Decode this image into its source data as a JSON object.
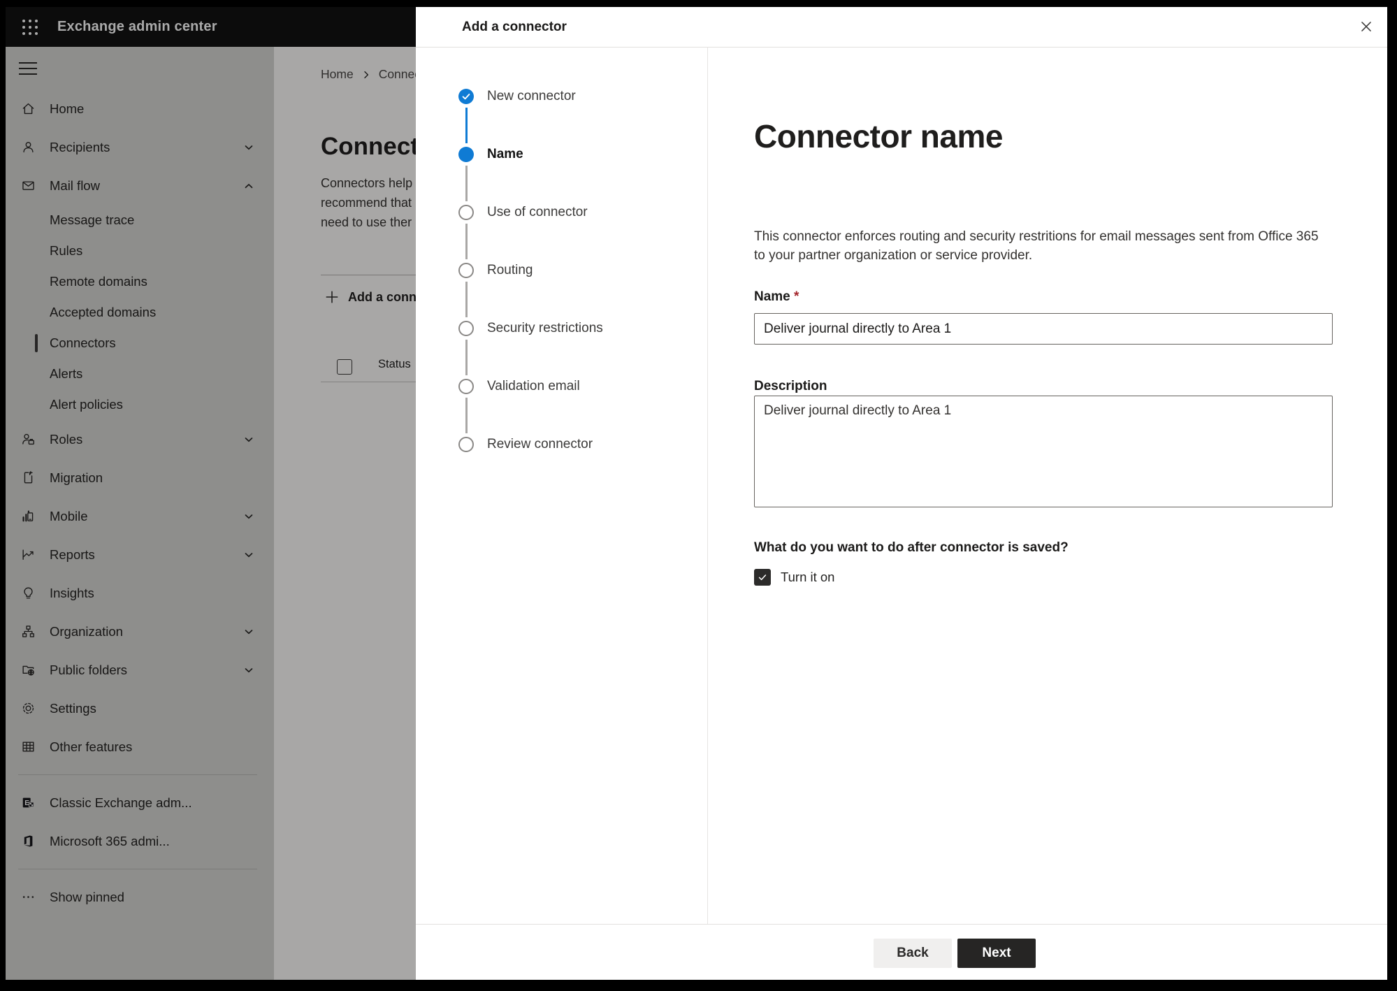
{
  "topbar": {
    "title": "Exchange admin center"
  },
  "sidebar": {
    "items": [
      {
        "label": "Home",
        "icon": "home-icon",
        "type": "item",
        "chevron": null,
        "selected": false
      },
      {
        "label": "Recipients",
        "icon": "person-icon",
        "type": "item",
        "chevron": "down",
        "selected": false
      },
      {
        "label": "Mail flow",
        "icon": "mail-icon",
        "type": "item",
        "chevron": "up",
        "selected": false
      },
      {
        "label": "Message trace",
        "icon": null,
        "type": "sub",
        "chevron": null,
        "selected": false
      },
      {
        "label": "Rules",
        "icon": null,
        "type": "sub",
        "chevron": null,
        "selected": false
      },
      {
        "label": "Remote domains",
        "icon": null,
        "type": "sub",
        "chevron": null,
        "selected": false
      },
      {
        "label": "Accepted domains",
        "icon": null,
        "type": "sub",
        "chevron": null,
        "selected": false
      },
      {
        "label": "Connectors",
        "icon": null,
        "type": "sub",
        "chevron": null,
        "selected": true
      },
      {
        "label": "Alerts",
        "icon": null,
        "type": "sub",
        "chevron": null,
        "selected": false
      },
      {
        "label": "Alert policies",
        "icon": null,
        "type": "sub",
        "chevron": null,
        "selected": false
      },
      {
        "label": "Roles",
        "icon": "roles-icon",
        "type": "item",
        "chevron": "down",
        "selected": false
      },
      {
        "label": "Migration",
        "icon": "migration-icon",
        "type": "item",
        "chevron": null,
        "selected": false
      },
      {
        "label": "Mobile",
        "icon": "mobile-icon",
        "type": "item",
        "chevron": "down",
        "selected": false
      },
      {
        "label": "Reports",
        "icon": "reports-icon",
        "type": "item",
        "chevron": "down",
        "selected": false
      },
      {
        "label": "Insights",
        "icon": "lightbulb-icon",
        "type": "item",
        "chevron": null,
        "selected": false
      },
      {
        "label": "Organization",
        "icon": "org-tree-icon",
        "type": "item",
        "chevron": "down",
        "selected": false
      },
      {
        "label": "Public folders",
        "icon": "folder-globe-icon",
        "type": "item",
        "chevron": "down",
        "selected": false
      },
      {
        "label": "Settings",
        "icon": "gear-icon",
        "type": "item",
        "chevron": null,
        "selected": false
      },
      {
        "label": "Other features",
        "icon": "grid-table-icon",
        "type": "item",
        "chevron": null,
        "selected": false
      }
    ],
    "footer_items": [
      {
        "label": "Classic Exchange adm...",
        "icon": "classic-exchange-icon"
      },
      {
        "label": "Microsoft 365 admi...",
        "icon": "microsoft-365-icon"
      }
    ],
    "show_pinned": "Show pinned"
  },
  "background_page": {
    "breadcrumb": [
      "Home",
      "Connectors"
    ],
    "page_title": "Connectors",
    "paragraph_lines": [
      "Connectors help",
      "recommend that",
      "need to use ther"
    ],
    "add_button_label": "Add a connector",
    "table_header_status": "Status"
  },
  "dialog": {
    "title": "Add a connector",
    "close_icon": "close-icon",
    "steps": [
      {
        "label": "New connector",
        "state": "done"
      },
      {
        "label": "Name",
        "state": "current"
      },
      {
        "label": "Use of connector",
        "state": "todo"
      },
      {
        "label": "Routing",
        "state": "todo"
      },
      {
        "label": "Security restrictions",
        "state": "todo"
      },
      {
        "label": "Validation email",
        "state": "todo"
      },
      {
        "label": "Review connector",
        "state": "todo"
      }
    ],
    "form": {
      "title": "Connector name",
      "description": "This connector enforces routing and security restritions for email messages sent from Office 365 to your partner organization or service provider.",
      "name_label": "Name",
      "required_asterisk": "*",
      "name_value": "Deliver journal directly to Area 1",
      "description_label": "Description",
      "description_value": "Deliver journal directly to Area 1",
      "after_save_question": "What do you want to do after connector is saved?",
      "turn_on_label": "Turn it on",
      "turn_on_checked": true
    },
    "footer": {
      "back_label": "Back",
      "next_label": "Next"
    }
  },
  "colors": {
    "accent_blue": "#0f7bd4",
    "topbar_bg": "#121212",
    "overlay": "rgba(0,0,0,0.335)",
    "required_red": "#a4262c",
    "next_button_bg": "#262524",
    "back_button_bg": "#f0efee"
  }
}
